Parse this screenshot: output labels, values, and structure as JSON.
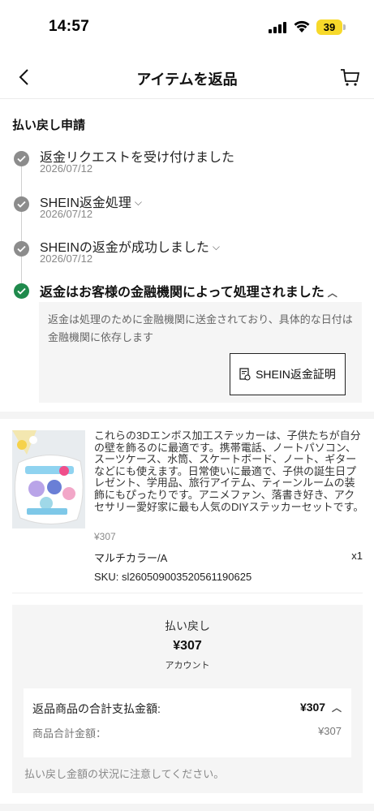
{
  "status_bar": {
    "time": "14:57",
    "battery": "39",
    "battery_color": "#f7d92a"
  },
  "header": {
    "title": "アイテムを返品",
    "back_icon": "chevron-left-icon",
    "cart_icon": "cart-icon"
  },
  "refund": {
    "section_title": "払い戻し申請",
    "steps": [
      {
        "label": "返金リクエストを受け付けました",
        "date": "2026/07/12",
        "expandable": false
      },
      {
        "label": "SHEIN返金処理",
        "date": "2026/07/12",
        "expandable": true
      },
      {
        "label": "SHEINの返金が成功しました",
        "date": "2026/07/12",
        "expandable": true
      },
      {
        "label": "返金はお客様の金融機関によって処理されました",
        "date": "",
        "expandable": true,
        "expanded": true
      }
    ],
    "info_text": "返金は処理のために金融機関に送金されており、具体的な日付は金融機関に依存します",
    "proof_button": "SHEIN返金証明",
    "done_color": "#1f8a4c"
  },
  "product": {
    "description": "これらの3Dエンボス加工ステッカーは、子供たちが自分の壁を飾るのに最適です。携帯電話、ノートパソコン、スーツケース、水筒、スケートボード、ノート、ギターなどにも使えます。日常使いに最適で、子供の誕生日プレゼント、学用品、旅行アイテム、ティーンルームの装飾にもぴったりです。アニメファン、落書き好き、アクセサリー愛好家に最も人気のDIYステッカーセットです。",
    "price": "¥307",
    "variant": "マルチカラー/A",
    "quantity": "x1",
    "sku": "SKU: sl2605090035205611906​25"
  },
  "summary": {
    "label": "払い戻し",
    "amount": "¥307",
    "method": "アカウント",
    "total_label": "返品商品の合計支払金額:",
    "total_value": "¥307",
    "subtotal_label": "商品合計金額：",
    "subtotal_value": "¥307",
    "note": "払い戻し金額の状況に注意してください。"
  }
}
